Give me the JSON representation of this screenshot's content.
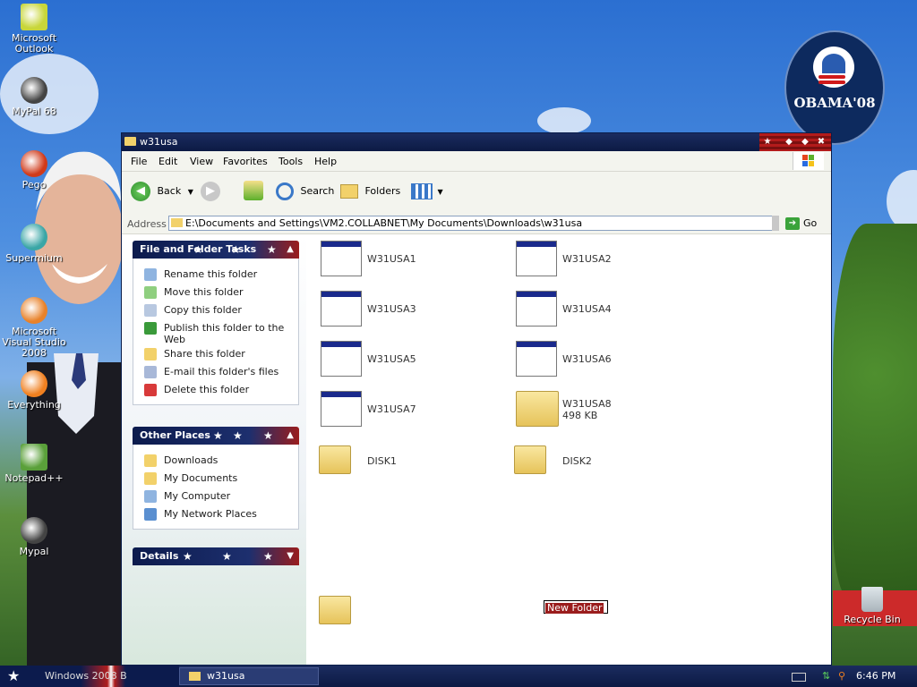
{
  "desktop": {
    "icons": [
      {
        "label": "Microsoft Outlook",
        "icon": "outlook-icon",
        "color": "#c8d63a"
      },
      {
        "label": "MyPal 68",
        "icon": "raccoon-icon",
        "color": "#444"
      },
      {
        "label": "Pego",
        "icon": "pego-icon",
        "color": "#d03a1a"
      },
      {
        "label": "Supermium",
        "icon": "supermium-icon",
        "color": "#3aa6a6"
      },
      {
        "label": "Microsoft Visual Studio 2008",
        "icon": "visual-studio-icon",
        "color": "#e8822a"
      },
      {
        "label": "Everything",
        "icon": "search-icon",
        "color": "#f08020"
      },
      {
        "label": "Notepad++",
        "icon": "notepadpp-icon",
        "color": "#5aa03a"
      },
      {
        "label": "Mypal",
        "icon": "raccoon-icon",
        "color": "#444"
      }
    ],
    "recycle_bin": "Recycle Bin",
    "badge": {
      "text": "OBAMA'08"
    }
  },
  "window": {
    "title": "w31usa",
    "menu": [
      "File",
      "Edit",
      "View",
      "Favorites",
      "Tools",
      "Help"
    ],
    "toolbar": {
      "back": "Back",
      "search": "Search",
      "folders": "Folders"
    },
    "address": {
      "label": "Address",
      "value": "E:\\Documents and Settings\\VM2.COLLABNET\\My Documents\\Downloads\\w31usa",
      "go": "Go"
    }
  },
  "tasks": {
    "file_folder": {
      "title": "File and Folder Tasks",
      "items": [
        "Rename this folder",
        "Move this folder",
        "Copy this folder",
        "Publish this folder to the Web",
        "Share this folder",
        "E-mail this folder's files",
        "Delete this folder"
      ]
    },
    "other_places": {
      "title": "Other Places",
      "items": [
        "Downloads",
        "My Documents",
        "My Computer",
        "My Network Places"
      ]
    },
    "details": {
      "title": "Details"
    }
  },
  "files": [
    {
      "name": "W31USA1",
      "type": "window"
    },
    {
      "name": "W31USA2",
      "type": "window"
    },
    {
      "name": "W31USA3",
      "type": "window"
    },
    {
      "name": "W31USA4",
      "type": "window"
    },
    {
      "name": "W31USA5",
      "type": "window"
    },
    {
      "name": "W31USA6",
      "type": "window"
    },
    {
      "name": "W31USA7",
      "type": "window"
    },
    {
      "name": "W31USA8",
      "type": "zip",
      "size": "498 KB"
    },
    {
      "name": "DISK1",
      "type": "folder"
    },
    {
      "name": "DISK2",
      "type": "folder"
    }
  ],
  "rename_field": "New Folder",
  "taskbar": {
    "start_label": "Windows 2008 B",
    "task": "w31usa",
    "clock": "6:46 PM"
  },
  "colors": {
    "title_dark": "#0c1a44",
    "accent_red": "#9a1d1d",
    "panel_blue": "#1d2f6e"
  }
}
